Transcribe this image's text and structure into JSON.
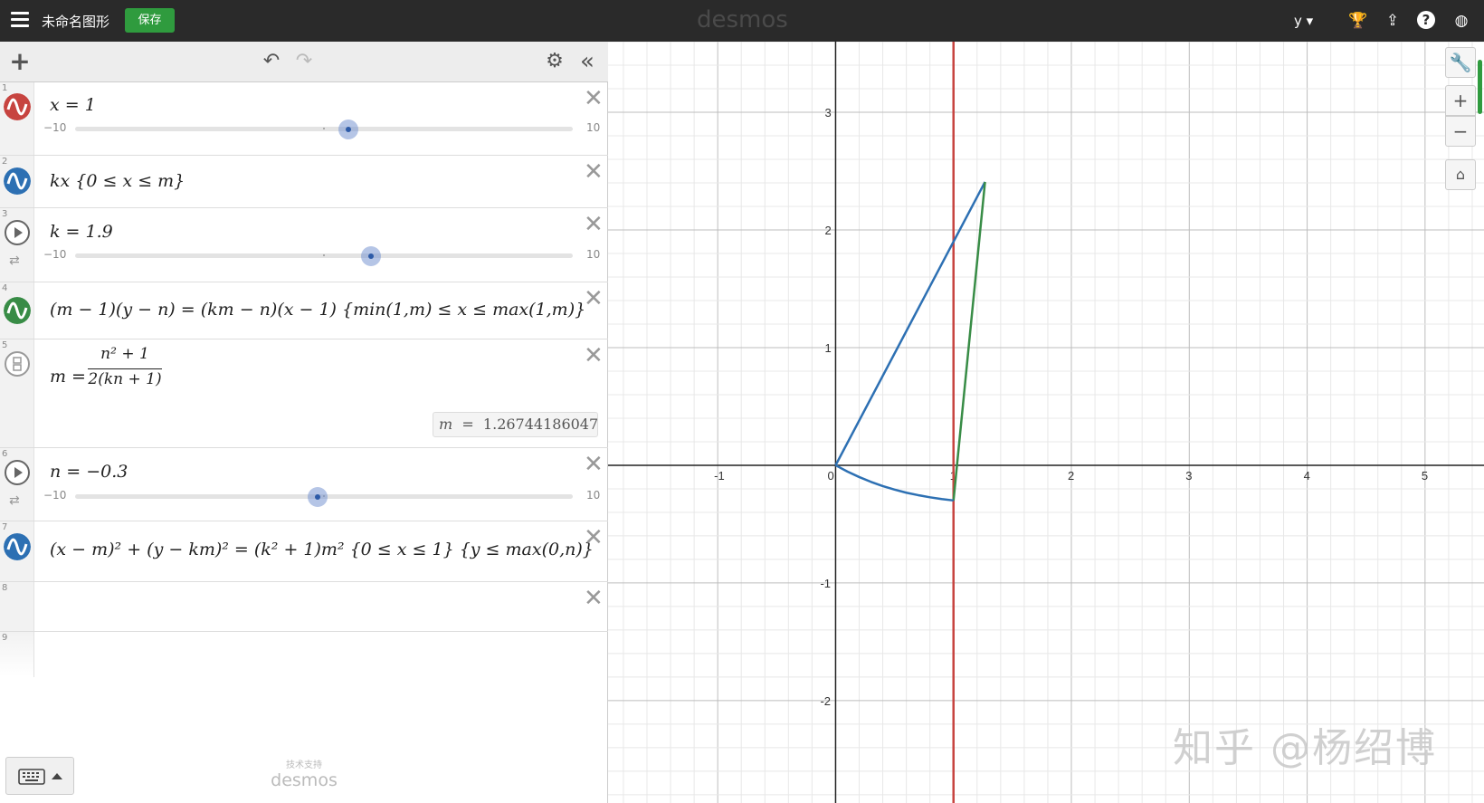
{
  "topbar": {
    "title": "未命名图形",
    "save_label": "保存",
    "brand": "desmos",
    "user_label": "y",
    "icons": [
      "menu-icon",
      "trophy-icon",
      "share-icon",
      "help-icon",
      "globe-icon"
    ]
  },
  "toolbar": {
    "icons": [
      "add-icon",
      "undo-icon",
      "redo-icon",
      "settings-icon",
      "collapse-icon"
    ]
  },
  "expressions": [
    {
      "index": "1",
      "latex": "x = 1",
      "slider": {
        "min": "−10",
        "max": "10",
        "value": 1
      },
      "color": "#c74440"
    },
    {
      "index": "2",
      "latex": "kx {0 ≤ x ≤ m}",
      "color": "#2d70b3"
    },
    {
      "index": "3",
      "latex": "k = 1.9",
      "slider": {
        "min": "−10",
        "max": "10",
        "value": 1.9
      }
    },
    {
      "index": "4",
      "latex": "(m − 1)(y − n) = (km − n)(x − 1) {min(1,m) ≤ x ≤ max(1,m)}",
      "color": "#388c46"
    },
    {
      "index": "5",
      "latex_lhs": "m =",
      "numerator": "n² + 1",
      "denominator": "2(kn + 1)",
      "result_label": "m",
      "result_eq": "=",
      "result_value": "1.26744186047"
    },
    {
      "index": "6",
      "latex": "n = −0.3",
      "slider": {
        "min": "−10",
        "max": "10",
        "value": -0.3
      }
    },
    {
      "index": "7",
      "latex": "(x − m)² + (y − km)² = (k² + 1)m² {0 ≤ x ≤ 1} {y ≤ max(0,n)}",
      "color": "#2d70b3"
    },
    {
      "index": "8",
      "latex": ""
    },
    {
      "index": "9",
      "latex": ""
    }
  ],
  "footer": {
    "powered_small": "技术支持",
    "powered_brand": "desmos"
  },
  "graph": {
    "x_ticks": [
      "-1",
      "0",
      "1",
      "2",
      "3",
      "4",
      "5"
    ],
    "y_ticks": [
      "3",
      "2",
      "1",
      "-1",
      "-2"
    ],
    "xlim": [
      -1.93,
      5.5
    ],
    "ylim": [
      -2.87,
      3.6
    ],
    "controls": [
      "wrench-icon",
      "zoom-in-icon",
      "zoom-out-icon",
      "home-icon"
    ],
    "watermark": "知乎 @杨绍博"
  },
  "chart_data": {
    "type": "line",
    "title": "",
    "xlabel": "",
    "ylabel": "",
    "xlim": [
      -1.93,
      5.5
    ],
    "ylim": [
      -2.87,
      3.6
    ],
    "grid": true,
    "series": [
      {
        "color": "#c74440",
        "x": [
          1,
          1
        ],
        "y": [
          -2.87,
          3.6
        ]
      },
      {
        "color": "#2d70b3",
        "x": [
          0,
          1.2674
        ],
        "y": [
          0,
          2.408
        ]
      },
      {
        "color": "#388c46",
        "x": [
          1,
          1.2674
        ],
        "y": [
          -0.3,
          2.408
        ]
      },
      {
        "color": "#2d70b3",
        "x": [
          0,
          0.1,
          0.2,
          0.3,
          0.4,
          0.5,
          0.6,
          0.7,
          0.8,
          0.9,
          1.0
        ],
        "y": [
          0,
          -0.053,
          -0.1,
          -0.141,
          -0.177,
          -0.207,
          -0.233,
          -0.254,
          -0.272,
          -0.287,
          -0.299
        ]
      }
    ]
  }
}
